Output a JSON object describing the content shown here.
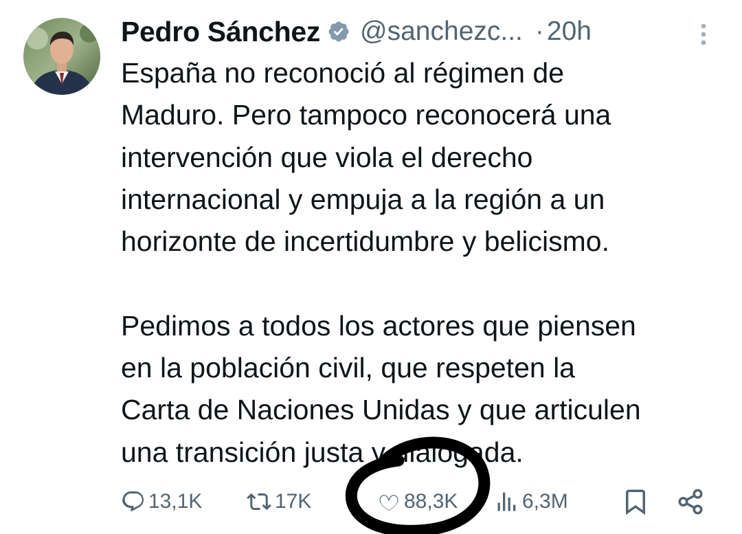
{
  "tweet": {
    "author": {
      "name": "Pedro Sánchez",
      "handle": "@sanchezc...",
      "separator": "·",
      "time": "20h"
    },
    "lines": [
      "España no reconoció al régimen de",
      "Maduro. Pero tampoco reconocerá una",
      "intervención que viola el derecho",
      "internacional y empuja a la región a un",
      "horizonte de incertidumbre y belicismo.",
      "",
      "Pedimos a todos los actores que piensen",
      "en la población civil, que respeten la",
      "Carta de Naciones Unidas y que articulen",
      "una transición justa y dialogada."
    ],
    "actions": {
      "replies": "13,1K",
      "reposts": "17K",
      "likes": "88,3K",
      "views": "6,3M"
    }
  },
  "icons": {
    "verified": "verified-badge-icon",
    "more": "more-vertical-icon",
    "reply": "reply-icon",
    "repost": "repost-icon",
    "like": "heart-icon",
    "views": "views-chart-icon",
    "bookmark": "bookmark-icon",
    "share": "share-icon"
  },
  "colors": {
    "text": "#0f1419",
    "secondary": "#536471",
    "verified_badge": "#829aab",
    "annotation": "#000000"
  }
}
